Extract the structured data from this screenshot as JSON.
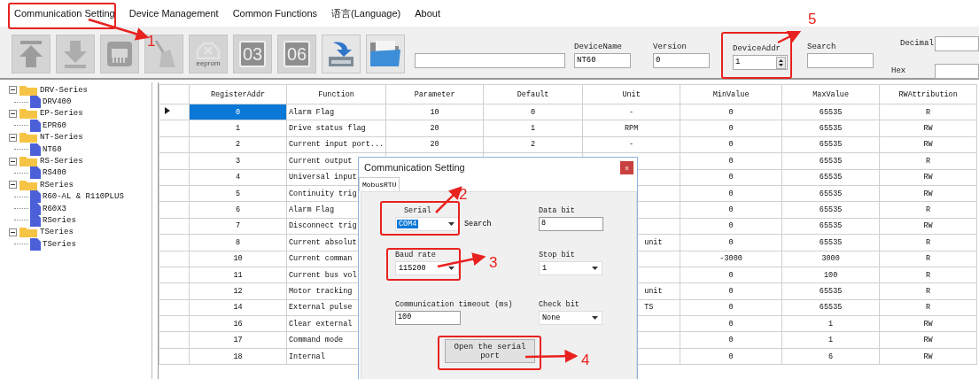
{
  "menu": [
    "Communication Setting",
    "Device Management",
    "Common Functions",
    "语言(Language)",
    "About"
  ],
  "toolbar": {
    "buttons": [
      {
        "kind": "upload",
        "disabled": true
      },
      {
        "kind": "download",
        "disabled": true
      },
      {
        "kind": "chip",
        "disabled": true
      },
      {
        "kind": "broom",
        "disabled": true
      },
      {
        "kind": "eeprom",
        "label": "eeprom",
        "disabled": true
      },
      {
        "kind": "number",
        "label": "03",
        "disabled": true
      },
      {
        "kind": "number",
        "label": "06",
        "disabled": true
      },
      {
        "kind": "save",
        "disabled": false
      },
      {
        "kind": "folder",
        "disabled": false
      }
    ],
    "device_name": {
      "label": "DeviceName",
      "value": "NT60"
    },
    "version": {
      "label": "Version",
      "value": "0"
    },
    "device_addr": {
      "label": "DeviceAddr",
      "value": "1"
    },
    "search": {
      "label": "Search"
    },
    "decimal": {
      "label": "Decimal"
    },
    "hex": {
      "label": "Hex"
    }
  },
  "tree": [
    {
      "label": "DRV-Series",
      "expanded": true,
      "children": [
        {
          "label": "DRV400"
        }
      ]
    },
    {
      "label": "EP-Series",
      "expanded": true,
      "children": [
        {
          "label": "EPR60"
        }
      ]
    },
    {
      "label": "NT-Series",
      "expanded": true,
      "children": [
        {
          "label": "NT60"
        }
      ]
    },
    {
      "label": "RS-Series",
      "expanded": true,
      "children": [
        {
          "label": "RS400"
        }
      ]
    },
    {
      "label": "RSeries",
      "expanded": true,
      "children": [
        {
          "label": "R60-AL & R110PLUS"
        },
        {
          "label": "R60X3"
        },
        {
          "label": "RSeries"
        }
      ]
    },
    {
      "label": "TSeries",
      "expanded": true,
      "children": [
        {
          "label": "TSeries"
        }
      ]
    }
  ],
  "table": {
    "columns": [
      "RegisterAddr",
      "Function",
      "Parameter",
      "Default",
      "Unit",
      "MinValue",
      "MaxValue",
      "RWAttribution"
    ],
    "rows": [
      {
        "selected": true,
        "cells": [
          "0",
          "Alarm Flag",
          "10",
          "0",
          "-",
          "0",
          "65535",
          "R"
        ]
      },
      {
        "selected": false,
        "cells": [
          "1",
          "Drive status flag",
          "20",
          "1",
          "RPM",
          "0",
          "65535",
          "RW"
        ]
      },
      {
        "selected": false,
        "cells": [
          "2",
          "Current input port...",
          "20",
          "2",
          "-",
          "0",
          "65535",
          "RW"
        ]
      },
      {
        "selected": false,
        "cells": [
          "3",
          "Current output",
          null,
          null,
          null,
          "0",
          "65535",
          "R"
        ]
      },
      {
        "selected": false,
        "cells": [
          "4",
          "Universal input",
          null,
          null,
          null,
          "0",
          "65535",
          "RW"
        ]
      },
      {
        "selected": false,
        "cells": [
          "5",
          "Continuity trig",
          null,
          null,
          null,
          "0",
          "65535",
          "RW"
        ]
      },
      {
        "selected": false,
        "cells": [
          "6",
          "Alarm Flag",
          null,
          null,
          null,
          "0",
          "65535",
          "R"
        ]
      },
      {
        "selected": false,
        "cells": [
          "7",
          "Disconnect trig",
          null,
          null,
          null,
          "0",
          "65535",
          "RW"
        ]
      },
      {
        "selected": false,
        "cells": [
          "8",
          "Current absolut",
          null,
          null,
          "unit",
          "0",
          "65535",
          "R"
        ]
      },
      {
        "selected": false,
        "cells": [
          "10",
          "Current comman",
          null,
          null,
          null,
          "-3000",
          "3000",
          "R"
        ]
      },
      {
        "selected": false,
        "cells": [
          "11",
          "Current bus vol",
          null,
          null,
          null,
          "0",
          "100",
          "R"
        ]
      },
      {
        "selected": false,
        "cells": [
          "12",
          "Motor tracking",
          null,
          null,
          "unit",
          "0",
          "65535",
          "R"
        ]
      },
      {
        "selected": false,
        "cells": [
          "14",
          "External pulse",
          null,
          null,
          "TS",
          "0",
          "65535",
          "R"
        ]
      },
      {
        "selected": false,
        "cells": [
          "16",
          "Clear external",
          null,
          null,
          null,
          "0",
          "1",
          "RW"
        ]
      },
      {
        "selected": false,
        "cells": [
          "17",
          "Command mode",
          null,
          null,
          null,
          "0",
          "1",
          "RW"
        ]
      },
      {
        "selected": false,
        "cells": [
          "18",
          "Internal",
          null,
          null,
          null,
          "0",
          "6",
          "RW"
        ]
      }
    ]
  },
  "dialog": {
    "title": "Communication Setting",
    "close": "x",
    "tab": {
      "label": "MobusRTU",
      "selected": true
    },
    "serial": {
      "label": "Serial",
      "value": "COM4",
      "text_selected": true
    },
    "search_label": "Search",
    "data_bit": {
      "label": "Data bit",
      "value": "8"
    },
    "baud_rate": {
      "label": "Baud rate",
      "value": "115200"
    },
    "stop_bit": {
      "label": "Stop bit",
      "value": "1"
    },
    "timeout": {
      "label": "Communication timeout (ms)",
      "value": "100"
    },
    "check_bit": {
      "label": "Check bit",
      "value": "None"
    },
    "button": "Open the serial port"
  },
  "annotations": [
    {
      "label": "1"
    },
    {
      "label": "2"
    },
    {
      "label": "3"
    },
    {
      "label": "4"
    },
    {
      "label": "5"
    }
  ]
}
